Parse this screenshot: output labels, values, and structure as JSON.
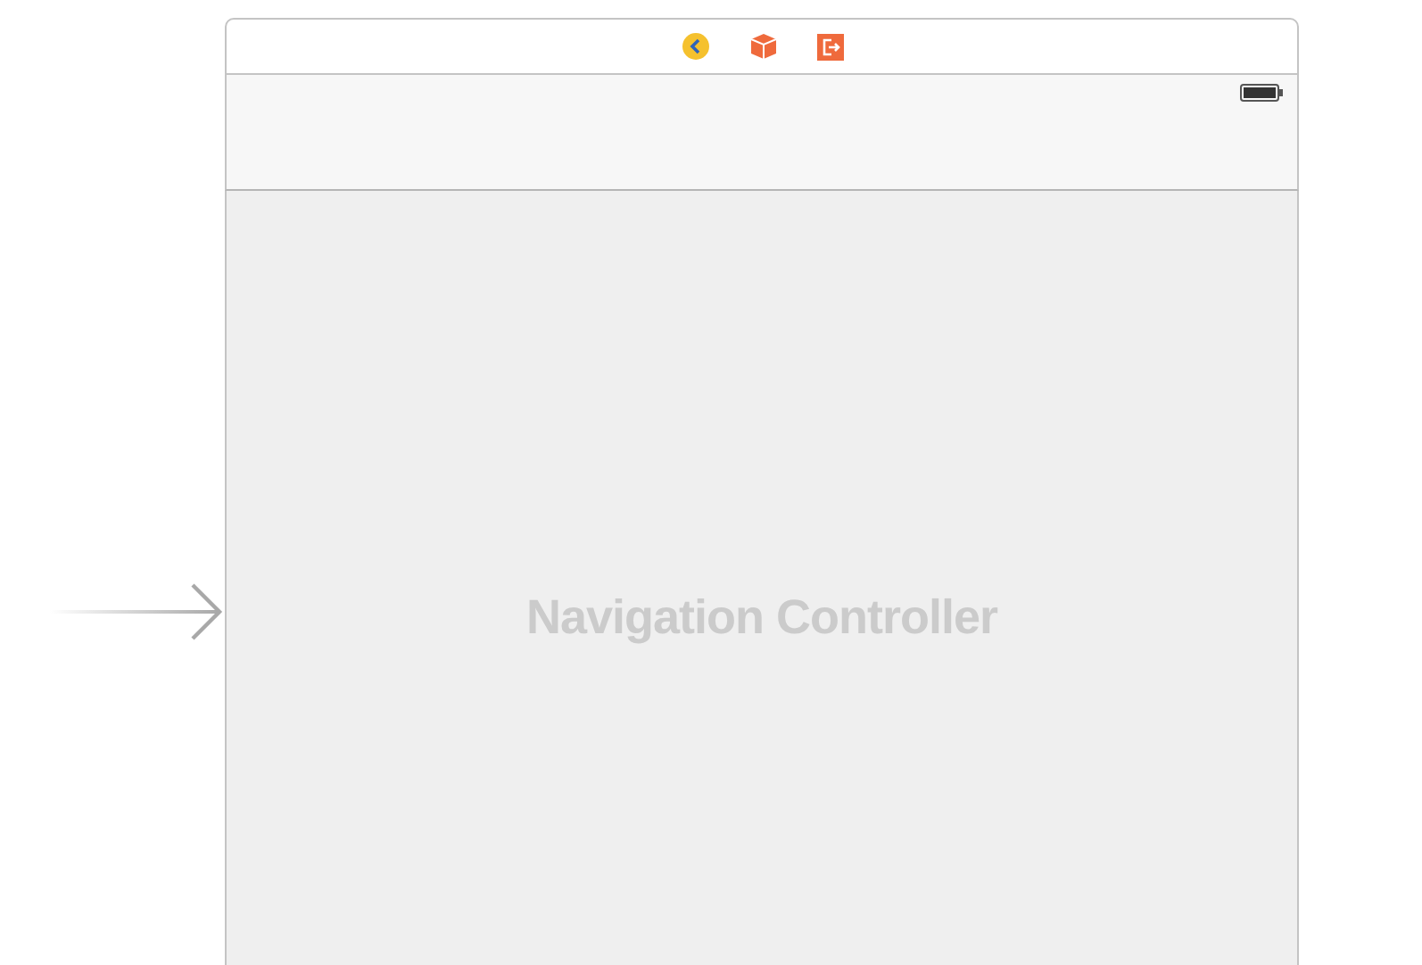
{
  "scene": {
    "title": "Navigation Controller",
    "initial": true
  }
}
